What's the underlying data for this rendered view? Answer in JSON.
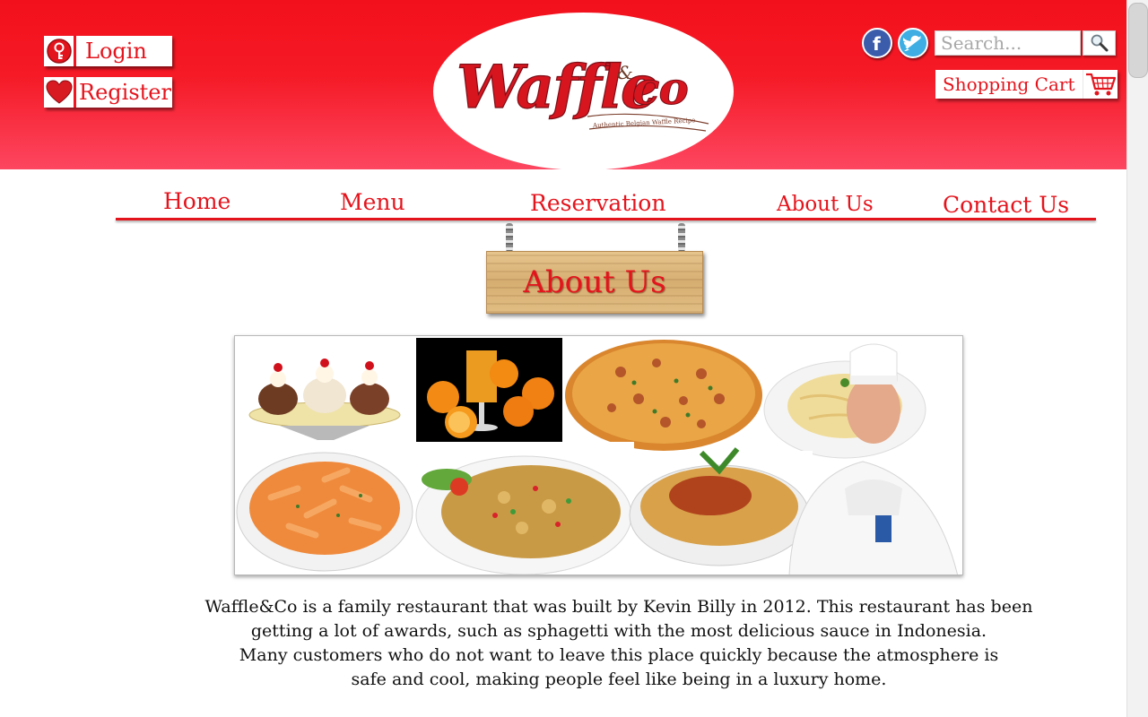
{
  "header": {
    "login_label": "Login",
    "register_label": "Register",
    "logo": {
      "brand": "Waffle&co",
      "tagline": "Authentic Belgian Waffle Recipe"
    },
    "search_placeholder": "Search...",
    "cart_label": "Shopping Cart",
    "social": [
      "facebook-icon",
      "twitter-icon"
    ]
  },
  "nav": {
    "items": [
      "Home",
      "Menu",
      "Reservation",
      "About Us",
      "Contact Us"
    ]
  },
  "page": {
    "sign_title": "About Us",
    "paragraph": [
      "Waffle&Co is a family restaurant that was built by Kevin Billy in 2012. This restaurant has been",
      "getting a lot of awards, such as sphagetti with the most delicious sauce in Indonesia.",
      "Many customers who do not want to leave this place quickly because the atmosphere is",
      "safe and cool, making people feel like being in a luxury home."
    ]
  },
  "colors": {
    "brand_red": "#e4141d",
    "header_top": "#f2101c",
    "header_bottom": "#fd4660"
  }
}
